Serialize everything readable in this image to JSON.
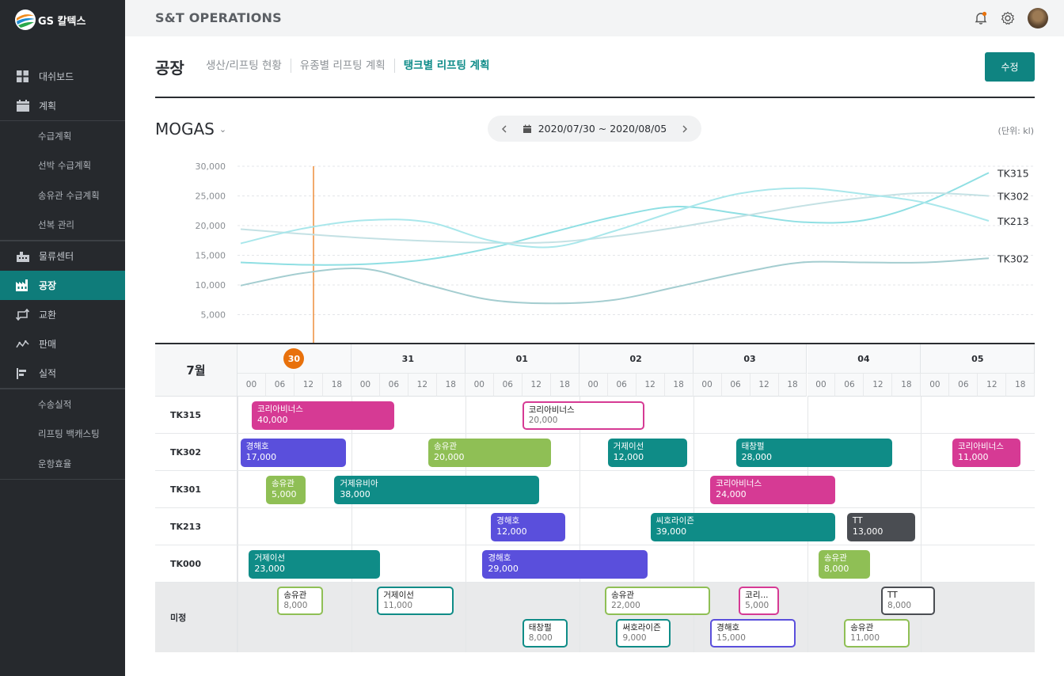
{
  "brand": {
    "name": "GS 칼텍스"
  },
  "sidebar": {
    "items": [
      {
        "label": "대쉬보드",
        "icon": "dashboard-grid-icon"
      },
      {
        "label": "계획",
        "icon": "calendar-icon"
      },
      {
        "label": "수급계획",
        "sub": true
      },
      {
        "label": "선박 수급계획",
        "sub": true
      },
      {
        "label": "송유관 수급계획",
        "sub": true
      },
      {
        "label": "선복 관리",
        "sub": true
      },
      {
        "label": "물류센터",
        "icon": "warehouse-icon"
      },
      {
        "label": "공장",
        "icon": "factory-icon",
        "active": true
      },
      {
        "label": "교환",
        "icon": "exchange-icon"
      },
      {
        "label": "판매",
        "icon": "trend-icon"
      },
      {
        "label": "실적",
        "icon": "bar-list-icon"
      },
      {
        "label": "수송실적",
        "sub": true
      },
      {
        "label": "리프팅 백캐스팅",
        "sub": true
      },
      {
        "label": "운항효율",
        "sub": true
      }
    ]
  },
  "topbar": {
    "title": "S&T OPERATIONS"
  },
  "page": {
    "title": "공장",
    "tabs": [
      {
        "label": "생산/리프팅 현황",
        "active": false
      },
      {
        "label": "유종별 리프팅 계획",
        "active": false
      },
      {
        "label": "탱크별 리프팅 계획",
        "active": true
      }
    ],
    "edit_label": "수정"
  },
  "chart_header": {
    "product": "MOGAS",
    "date_range": "2020/07/30 ~ 2020/08/05",
    "unit": "(단위: kl)"
  },
  "chart_data": {
    "type": "line",
    "ylim": [
      0,
      30000
    ],
    "yticks": [
      "30,000",
      "25,000",
      "20,000",
      "15,000",
      "10,000",
      "5,000"
    ],
    "x": [
      0,
      1,
      2,
      3,
      4,
      5,
      6,
      7,
      8,
      9,
      10,
      11,
      12
    ],
    "series": [
      {
        "name": "TK315",
        "color": "#8fdfe3",
        "values": [
          13800,
          13400,
          13500,
          14300,
          16200,
          18900,
          21500,
          23200,
          22000,
          20600,
          20900,
          24000,
          28900
        ]
      },
      {
        "name": "TK302",
        "color": "#c4e1e4",
        "values": [
          19400,
          18600,
          17900,
          17400,
          17100,
          17200,
          18200,
          19700,
          21500,
          23300,
          24700,
          25500,
          25000
        ]
      },
      {
        "name": "TK213",
        "color": "#a9e7eb",
        "values": [
          17000,
          19500,
          20900,
          20600,
          17500,
          16400,
          19100,
          22500,
          25400,
          26300,
          25300,
          23800,
          20800
        ]
      },
      {
        "name": "TK302",
        "color": "#a4cdd0",
        "values": [
          9900,
          12000,
          12700,
          10000,
          7500,
          6900,
          7500,
          9700,
          12000,
          13800,
          13800,
          13800,
          14500
        ]
      }
    ],
    "current_marker": "30 00–06"
  },
  "gantt": {
    "month": "7월",
    "days": [
      {
        "label": "30",
        "today": true
      },
      {
        "label": "31"
      },
      {
        "label": "01"
      },
      {
        "label": "02"
      },
      {
        "label": "03"
      },
      {
        "label": "04"
      },
      {
        "label": "05"
      }
    ],
    "hours": [
      "00",
      "06",
      "12",
      "18"
    ],
    "rows": [
      "TK315",
      "TK302",
      "TK301",
      "TK213",
      "TK000"
    ],
    "unassigned_label": "미정",
    "colors": {
      "pink": "#d63a94",
      "purple": "#5a4fdc",
      "lime": "#8fbf55",
      "teal": "#0f8c87",
      "dark": "#4a4d52"
    },
    "bars": [
      {
        "row": 0,
        "name": "코리아비너스",
        "amount": "40,000",
        "color": "pink",
        "start": 0.5,
        "end": 5.5
      },
      {
        "row": 0,
        "name": "코리아비너스",
        "amount": "20,000",
        "color": "pink",
        "start": 10,
        "end": 14.3,
        "outline": true
      },
      {
        "row": 1,
        "name": "경해호",
        "amount": "17,000",
        "color": "purple",
        "start": 0.1,
        "end": 3.8
      },
      {
        "row": 1,
        "name": "송유관",
        "amount": "20,000",
        "color": "lime",
        "start": 6.7,
        "end": 11
      },
      {
        "row": 1,
        "name": "거제이선",
        "amount": "12,000",
        "color": "teal",
        "start": 13,
        "end": 15.8
      },
      {
        "row": 1,
        "name": "태창펄",
        "amount": "28,000",
        "color": "teal",
        "start": 17.5,
        "end": 23
      },
      {
        "row": 1,
        "name": "코리아비너스",
        "amount": "11,000",
        "color": "pink",
        "start": 25.1,
        "end": 27.5
      },
      {
        "row": 2,
        "name": "송유관",
        "amount": "5,000",
        "color": "lime",
        "start": 1,
        "end": 2.4
      },
      {
        "row": 2,
        "name": "거제유비아",
        "amount": "38,000",
        "color": "teal",
        "start": 3.4,
        "end": 10.6
      },
      {
        "row": 2,
        "name": "코리아비너스",
        "amount": "24,000",
        "color": "pink",
        "start": 16.6,
        "end": 21
      },
      {
        "row": 3,
        "name": "경해호",
        "amount": "12,000",
        "color": "purple",
        "start": 8.9,
        "end": 11.5
      },
      {
        "row": 3,
        "name": "씨호라이즌",
        "amount": "39,000",
        "color": "teal",
        "start": 14.5,
        "end": 21
      },
      {
        "row": 3,
        "name": "TT",
        "amount": "13,000",
        "color": "dark",
        "start": 21.4,
        "end": 23.8
      },
      {
        "row": 4,
        "name": "거제이선",
        "amount": "23,000",
        "color": "teal",
        "start": 0.4,
        "end": 5
      },
      {
        "row": 4,
        "name": "경해호",
        "amount": "29,000",
        "color": "purple",
        "start": 8.6,
        "end": 14.4
      },
      {
        "row": 4,
        "name": "송유관",
        "amount": "8,000",
        "color": "lime",
        "start": 20.4,
        "end": 22.2
      }
    ],
    "unassigned": [
      {
        "name": "송유관",
        "amount": "8,000",
        "color": "lime",
        "start": 1.4,
        "end": 3,
        "line": 0
      },
      {
        "name": "거제이선",
        "amount": "11,000",
        "color": "teal",
        "start": 4.9,
        "end": 7.6,
        "line": 0
      },
      {
        "name": "송유관",
        "amount": "22,000",
        "color": "lime",
        "start": 12.9,
        "end": 16.6,
        "line": 0
      },
      {
        "name": "코리...",
        "amount": "5,000",
        "color": "pink",
        "start": 17.6,
        "end": 19,
        "line": 0
      },
      {
        "name": "TT",
        "amount": "8,000",
        "color": "dark",
        "start": 22.6,
        "end": 24.5,
        "line": 0
      },
      {
        "name": "태창펄",
        "amount": "8,000",
        "color": "teal",
        "start": 10,
        "end": 11.6,
        "line": 1
      },
      {
        "name": "써호라이즌",
        "amount": "9,000",
        "color": "teal",
        "start": 13.3,
        "end": 15.2,
        "line": 1
      },
      {
        "name": "경해호",
        "amount": "15,000",
        "color": "purple",
        "start": 16.6,
        "end": 19.6,
        "line": 1
      },
      {
        "name": "송유관",
        "amount": "11,000",
        "color": "lime",
        "start": 21.3,
        "end": 23.6,
        "line": 1
      }
    ]
  }
}
